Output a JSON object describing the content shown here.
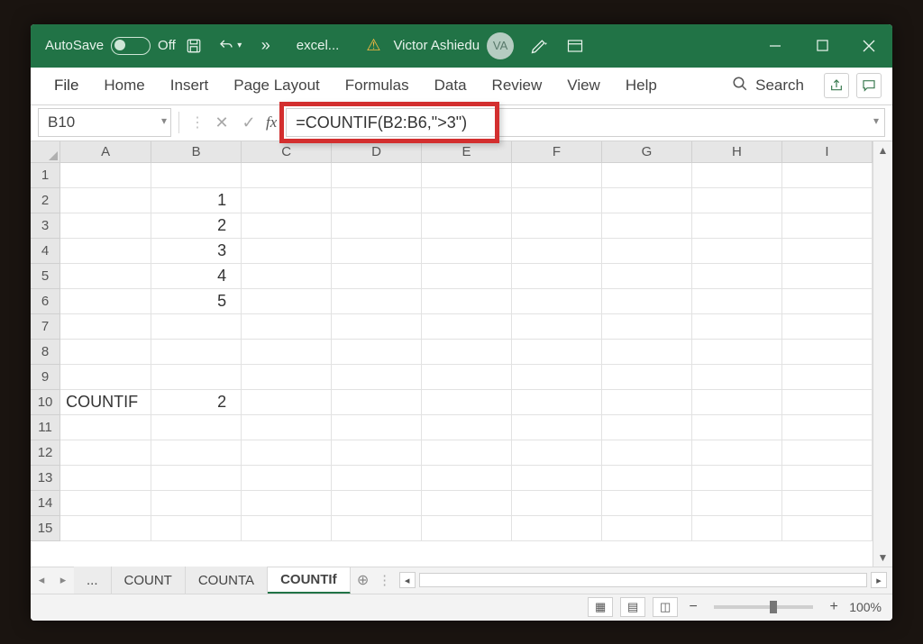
{
  "titlebar": {
    "autosave_label": "AutoSave",
    "autosave_state": "Off",
    "filename": "excel...",
    "username": "Victor Ashiedu",
    "avatar_initials": "VA"
  },
  "ribbon": {
    "tabs": [
      "File",
      "Home",
      "Insert",
      "Page Layout",
      "Formulas",
      "Data",
      "Review",
      "View",
      "Help"
    ],
    "search_label": "Search"
  },
  "formula_bar": {
    "namebox": "B10",
    "formula": "=COUNTIF(B2:B6,\">3\")"
  },
  "columns": [
    "A",
    "B",
    "C",
    "D",
    "E",
    "F",
    "G",
    "H",
    "I"
  ],
  "rows": [
    "1",
    "2",
    "3",
    "4",
    "5",
    "6",
    "7",
    "8",
    "9",
    "10",
    "11",
    "12",
    "13",
    "14",
    "15"
  ],
  "cells": {
    "A10": "COUNTIF",
    "B2": "1",
    "B3": "2",
    "B4": "3",
    "B5": "4",
    "B6": "5",
    "B10": "2"
  },
  "sheet_tabs": {
    "ellipsis": "...",
    "tabs": [
      "COUNT",
      "COUNTA",
      "COUNTIf"
    ],
    "active_index": 2
  },
  "statusbar": {
    "zoom": "100%"
  }
}
